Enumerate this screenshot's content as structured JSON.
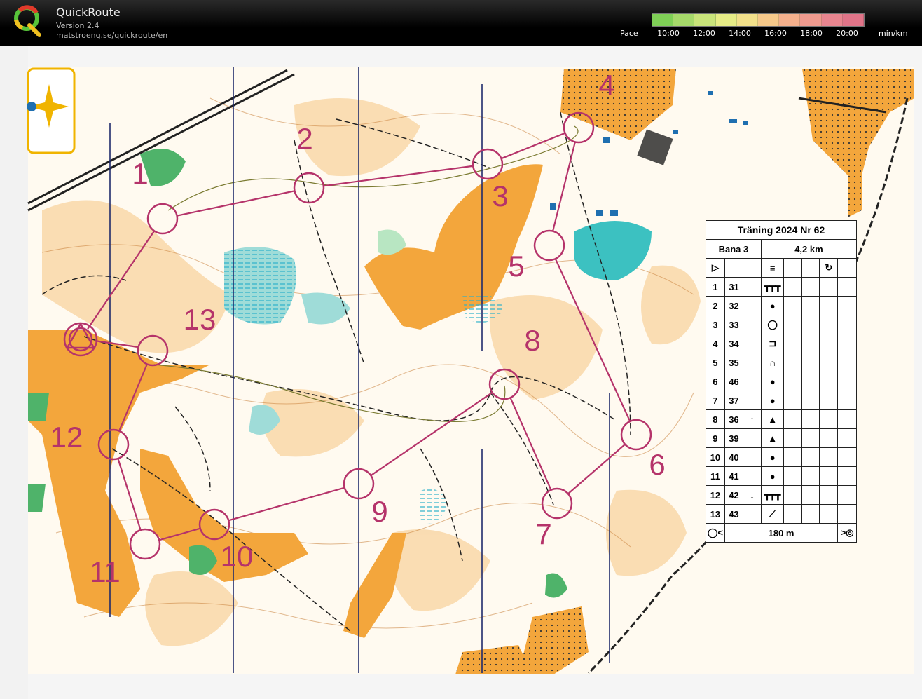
{
  "app": {
    "title": "QuickRoute",
    "version": "Version 2.4",
    "url": "matstroeng.se/quickroute/en"
  },
  "pace_scale": {
    "label": "Pace",
    "ticks": [
      "10:00",
      "12:00",
      "14:00",
      "16:00",
      "18:00",
      "20:00"
    ],
    "unit": "min/km",
    "colors": [
      "#7fcf56",
      "#a6d96a",
      "#c9e47a",
      "#e6ec86",
      "#f2e08a",
      "#f6c98a",
      "#f4b08c",
      "#ef9a8e",
      "#e8858f",
      "#e07488"
    ]
  },
  "course": {
    "color": "#b5336a",
    "start_label": "",
    "controls": [
      {
        "label": "1"
      },
      {
        "label": "2"
      },
      {
        "label": "3"
      },
      {
        "label": "4"
      },
      {
        "label": "5"
      },
      {
        "label": "6"
      },
      {
        "label": "7"
      },
      {
        "label": "8"
      },
      {
        "label": "9"
      },
      {
        "label": "10"
      },
      {
        "label": "11"
      },
      {
        "label": "12"
      },
      {
        "label": "13"
      }
    ]
  },
  "control_descriptions": {
    "title": "Träning 2024 Nr 62",
    "course": "Bana 3",
    "length": "4,2 km",
    "rows": [
      {
        "num": "1",
        "code": "31",
        "dir": "",
        "symbol": "┳┳┳"
      },
      {
        "num": "2",
        "code": "32",
        "dir": "",
        "symbol": "●"
      },
      {
        "num": "3",
        "code": "33",
        "dir": "",
        "symbol": "◯"
      },
      {
        "num": "4",
        "code": "34",
        "dir": "",
        "symbol": "⊐"
      },
      {
        "num": "5",
        "code": "35",
        "dir": "",
        "symbol": "∩"
      },
      {
        "num": "6",
        "code": "46",
        "dir": "",
        "symbol": "●"
      },
      {
        "num": "7",
        "code": "37",
        "dir": "",
        "symbol": "●"
      },
      {
        "num": "8",
        "code": "36",
        "dir": "↑",
        "symbol": "▲"
      },
      {
        "num": "9",
        "code": "39",
        "dir": "",
        "symbol": "▲"
      },
      {
        "num": "10",
        "code": "40",
        "dir": "",
        "symbol": "●"
      },
      {
        "num": "11",
        "code": "41",
        "dir": "",
        "symbol": "●"
      },
      {
        "num": "12",
        "code": "42",
        "dir": "↓",
        "symbol": "┳┳┳"
      },
      {
        "num": "13",
        "code": "43",
        "dir": "",
        "symbol": "⟋"
      }
    ],
    "finish_distance": "180 m"
  }
}
